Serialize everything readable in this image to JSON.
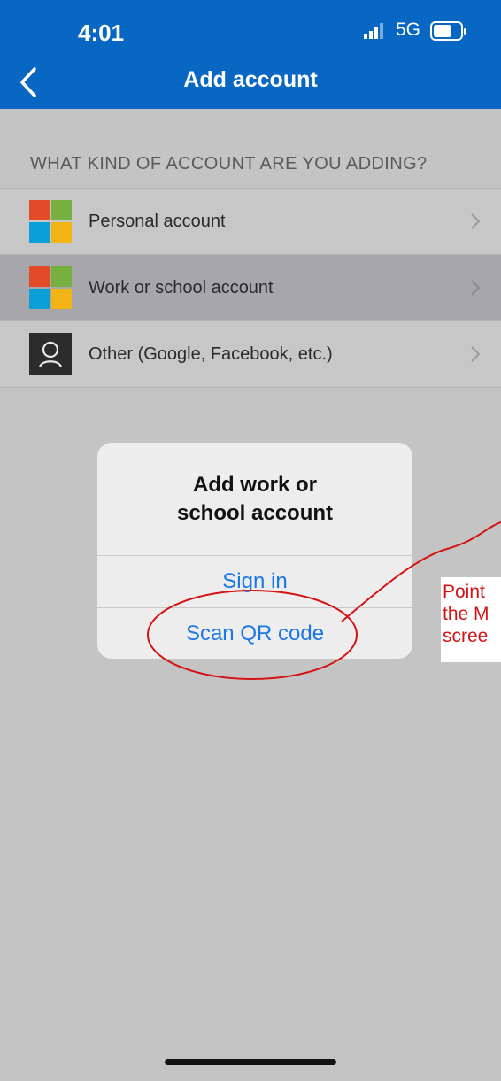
{
  "status": {
    "time": "4:01",
    "network": "5G"
  },
  "header": {
    "title": "Add account"
  },
  "section": {
    "heading": "WHAT KIND OF ACCOUNT ARE YOU ADDING?"
  },
  "accounts": [
    {
      "label": "Personal account",
      "icon": "microsoft-logo-icon"
    },
    {
      "label": "Work or school account",
      "icon": "microsoft-logo-icon",
      "selected": true
    },
    {
      "label": "Other (Google, Facebook, etc.)",
      "icon": "person-icon"
    }
  ],
  "dialog": {
    "title": "Add work or\nschool account",
    "actions": [
      "Sign in",
      "Scan QR code"
    ]
  },
  "annotation": {
    "text": "Point\nthe M\nscree"
  },
  "colors": {
    "accent": "#0867c2",
    "link": "#1a77e6",
    "annotation": "#d41414"
  }
}
